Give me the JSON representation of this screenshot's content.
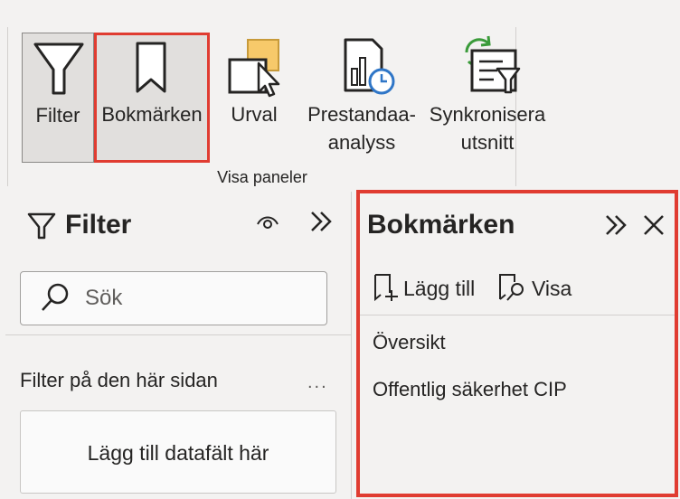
{
  "ribbon": {
    "buttons": [
      {
        "label": "Filter"
      },
      {
        "label": "Bokmärken"
      },
      {
        "label": "Urval"
      },
      {
        "label_line1": "Prestandaa-",
        "label_line2": "analyss"
      },
      {
        "label_line1": "Synkronisera",
        "label_line2": "utsnitt"
      }
    ],
    "group_label": "Visa paneler"
  },
  "filter_pane": {
    "title": "Filter",
    "search_placeholder": "Sök",
    "section_label": "Filter på den här sidan",
    "more": "...",
    "drop_text": "Lägg till datafält här"
  },
  "bookmarks_pane": {
    "title": "Bokmärken",
    "add_label": "Lägg till",
    "view_label": "Visa",
    "items": [
      "Översikt",
      "Offentlig säkerhet CIP"
    ]
  },
  "colors": {
    "highlight": "#e03c31",
    "accent_blue": "#2f76c7",
    "accent_green": "#3a9b3a",
    "accent_yellow": "#f7c96a"
  }
}
